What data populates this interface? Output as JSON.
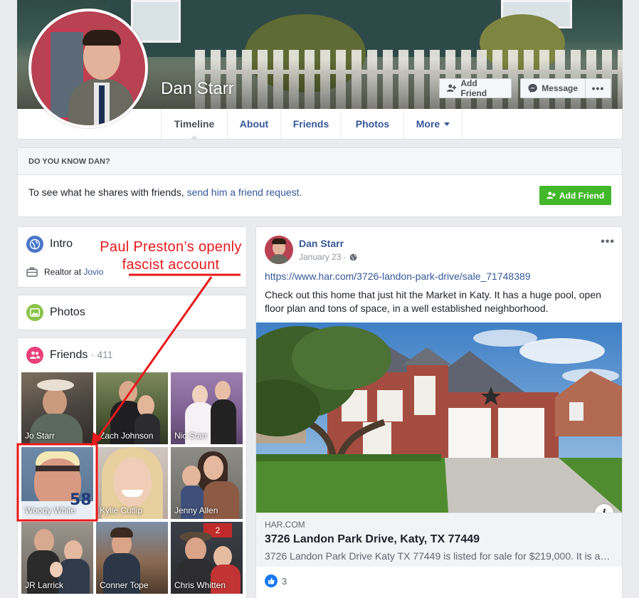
{
  "profile": {
    "name": "Dan Starr",
    "add_friend_label": "Add Friend",
    "message_label": "Message",
    "more_label": "•••"
  },
  "tabs": [
    {
      "label": "Timeline",
      "active": true
    },
    {
      "label": "About"
    },
    {
      "label": "Friends"
    },
    {
      "label": "Photos"
    },
    {
      "label": "More"
    }
  ],
  "know": {
    "heading": "DO YOU KNOW DAN?",
    "text": "To see what he shares with friends, ",
    "link": "send him a friend request.",
    "button": "Add Friend"
  },
  "intro": {
    "title": "Intro",
    "work_prefix": "Realtor at ",
    "work_link": "Jovio"
  },
  "photos": {
    "title": "Photos"
  },
  "friends": {
    "title": "Friends",
    "count": "· 411",
    "items": [
      {
        "name": "Jo Starr"
      },
      {
        "name": "Zach Johnson"
      },
      {
        "name": "Nic Starr"
      },
      {
        "name": "Woody White"
      },
      {
        "name": "Kylie Cutlip"
      },
      {
        "name": "Jenny Allen"
      },
      {
        "name": "JR Larrick"
      },
      {
        "name": "Conner Tope"
      },
      {
        "name": "Chris Whitten"
      }
    ]
  },
  "post": {
    "author": "Dan Starr",
    "date": "January 23 ·",
    "url": "https://www.har.com/3726-landon-park-drive/sale_71748389",
    "body": "Check out this home that just hit the Market in Katy. It has a huge pool, open floor plan and tons of space, in a well established neighborhood.",
    "link_source": "HAR.COM",
    "link_title": "3726 Landon Park Drive, Katy, TX 77449",
    "link_desc": "3726 Landon Park Drive Katy TX 77449 is listed for sale for $219,000. It is a…",
    "likes": "3",
    "menu": "•••",
    "info": "i"
  },
  "annotation": {
    "text_line1": "Paul Preston’s openly",
    "text_line2": "fascist account",
    "color": "#e8191b"
  },
  "colors": {
    "link": "#365899",
    "green": "#42b72a",
    "background": "#e9ebee"
  }
}
